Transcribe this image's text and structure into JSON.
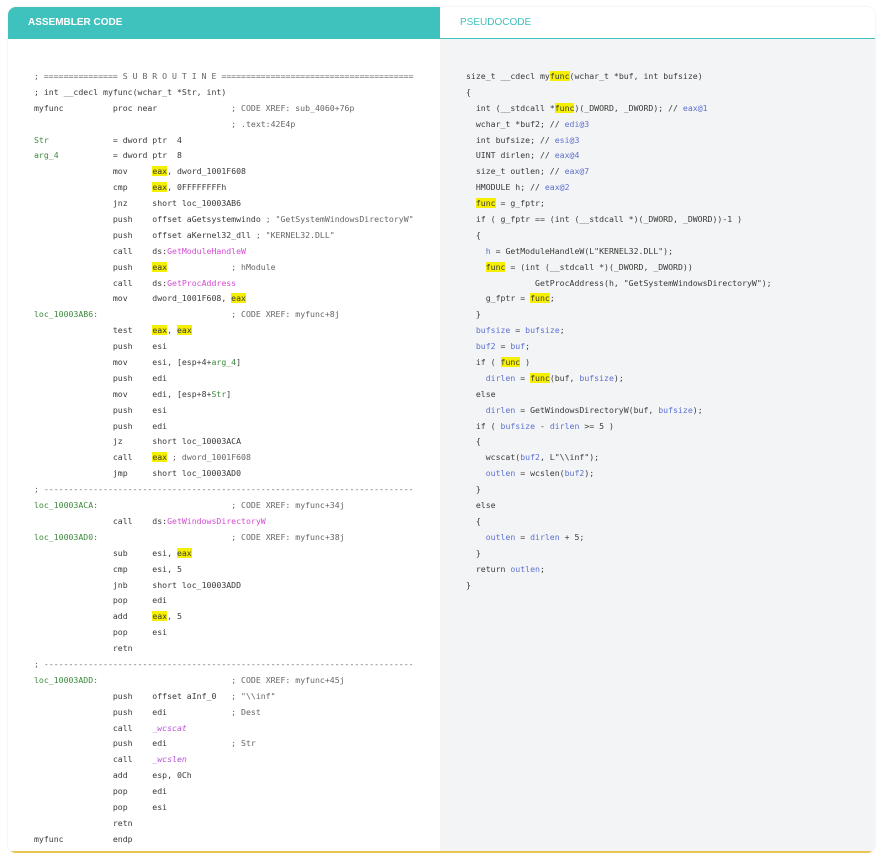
{
  "tabs": {
    "assembler": "ASSEMBLER CODE",
    "pseudocode": "PSEUDOCODE"
  },
  "colors": {
    "accent": "#3fc1bd",
    "highlight": "#f6f000",
    "label": "#3e8a3e",
    "function": "#d44bd4",
    "variable": "#5e71d1",
    "bottom_bar": "#e9c54d"
  },
  "assembler": [
    [
      {
        "t": "; =============== S U B R O U T I N E =======================================",
        "c": "cm"
      }
    ],
    [
      {
        "t": "; int __cdecl myfunc(wchar_t *Str, int)",
        "c": ""
      }
    ],
    [
      {
        "t": "myfunc          proc near               ",
        "c": ""
      },
      {
        "t": "; CODE XREF: sub_4060+76p",
        "c": "cm"
      }
    ],
    [
      {
        "t": "                                        ",
        "c": ""
      },
      {
        "t": "; .text:42E4p",
        "c": "cm"
      }
    ],
    [
      {
        "t": "Str",
        "c": "lbl"
      },
      {
        "t": "             = dword ptr  4",
        "c": ""
      }
    ],
    [
      {
        "t": "arg_4",
        "c": "lbl"
      },
      {
        "t": "           = dword ptr  8",
        "c": ""
      }
    ],
    [
      {
        "t": "                mov     ",
        "c": ""
      },
      {
        "t": "eax",
        "c": "hl"
      },
      {
        "t": ", dword_1001F608",
        "c": ""
      }
    ],
    [
      {
        "t": "                cmp     ",
        "c": ""
      },
      {
        "t": "eax",
        "c": "hl"
      },
      {
        "t": ", 0FFFFFFFFh",
        "c": ""
      }
    ],
    [
      {
        "t": "                jnz     short loc_10003AB6",
        "c": ""
      }
    ],
    [
      {
        "t": "                push    offset aGetsystemwindo ",
        "c": ""
      },
      {
        "t": "; \"GetSystemWindowsDirectoryW\"",
        "c": "cm"
      }
    ],
    [
      {
        "t": "                push    offset aKernel32_dll ",
        "c": ""
      },
      {
        "t": "; \"KERNEL32.DLL\"",
        "c": "cm"
      }
    ],
    [
      {
        "t": "                call    ds:",
        "c": ""
      },
      {
        "t": "GetModuleHandleW",
        "c": "fn"
      }
    ],
    [
      {
        "t": "                push    ",
        "c": ""
      },
      {
        "t": "eax",
        "c": "hl"
      },
      {
        "t": "             ",
        "c": ""
      },
      {
        "t": "; hModule",
        "c": "cm"
      }
    ],
    [
      {
        "t": "                call    ds:",
        "c": ""
      },
      {
        "t": "GetProcAddress",
        "c": "fn"
      }
    ],
    [
      {
        "t": "                mov     dword_1001F608, ",
        "c": ""
      },
      {
        "t": "eax",
        "c": "hl"
      }
    ],
    [
      {
        "t": "loc_10003AB6:",
        "c": "lbl"
      },
      {
        "t": "                           ",
        "c": ""
      },
      {
        "t": "; CODE XREF: myfunc+8j",
        "c": "cm"
      }
    ],
    [
      {
        "t": "                test    ",
        "c": ""
      },
      {
        "t": "eax",
        "c": "hl"
      },
      {
        "t": ", ",
        "c": ""
      },
      {
        "t": "eax",
        "c": "hl"
      }
    ],
    [
      {
        "t": "                push    esi",
        "c": ""
      }
    ],
    [
      {
        "t": "                mov     esi, [esp+4+",
        "c": ""
      },
      {
        "t": "arg_4",
        "c": "lbl"
      },
      {
        "t": "]",
        "c": ""
      }
    ],
    [
      {
        "t": "                push    edi",
        "c": ""
      }
    ],
    [
      {
        "t": "                mov     edi, [esp+8+",
        "c": ""
      },
      {
        "t": "Str",
        "c": "lbl"
      },
      {
        "t": "]",
        "c": ""
      }
    ],
    [
      {
        "t": "                push    esi",
        "c": ""
      }
    ],
    [
      {
        "t": "                push    edi",
        "c": ""
      }
    ],
    [
      {
        "t": "                jz      short loc_10003ACA",
        "c": ""
      }
    ],
    [
      {
        "t": "                call    ",
        "c": ""
      },
      {
        "t": "eax",
        "c": "hl"
      },
      {
        "t": " ",
        "c": ""
      },
      {
        "t": "; dword_1001F608",
        "c": "cm"
      }
    ],
    [
      {
        "t": "                jmp     short loc_10003AD0",
        "c": ""
      }
    ],
    [
      {
        "t": "; ---------------------------------------------------------------------------",
        "c": "cm"
      }
    ],
    [
      {
        "t": "loc_10003ACA:",
        "c": "lbl"
      },
      {
        "t": "                           ",
        "c": ""
      },
      {
        "t": "; CODE XREF: myfunc+34j",
        "c": "cm"
      }
    ],
    [
      {
        "t": "                call    ds:",
        "c": ""
      },
      {
        "t": "GetWindowsDirectoryW",
        "c": "fn"
      }
    ],
    [
      {
        "t": "loc_10003AD0:",
        "c": "lbl"
      },
      {
        "t": "                           ",
        "c": ""
      },
      {
        "t": "; CODE XREF: myfunc+38j",
        "c": "cm"
      }
    ],
    [
      {
        "t": "                sub     esi, ",
        "c": ""
      },
      {
        "t": "eax",
        "c": "hl"
      }
    ],
    [
      {
        "t": "                cmp     esi, 5",
        "c": ""
      }
    ],
    [
      {
        "t": "                jnb     short loc_10003ADD",
        "c": ""
      }
    ],
    [
      {
        "t": "                pop     edi",
        "c": ""
      }
    ],
    [
      {
        "t": "                add     ",
        "c": ""
      },
      {
        "t": "eax",
        "c": "hl"
      },
      {
        "t": ", 5",
        "c": ""
      }
    ],
    [
      {
        "t": "                pop     esi",
        "c": ""
      }
    ],
    [
      {
        "t": "                retn",
        "c": ""
      }
    ],
    [
      {
        "t": "; ---------------------------------------------------------------------------",
        "c": "cm"
      }
    ],
    [
      {
        "t": "loc_10003ADD:",
        "c": "lbl"
      },
      {
        "t": "                           ",
        "c": ""
      },
      {
        "t": "; CODE XREF: myfunc+45j",
        "c": "cm"
      }
    ],
    [
      {
        "t": "                push    offset aInf_0   ",
        "c": ""
      },
      {
        "t": "; \"\\\\inf\"",
        "c": "cm"
      }
    ],
    [
      {
        "t": "                push    edi             ",
        "c": ""
      },
      {
        "t": "; Dest",
        "c": "cm"
      }
    ],
    [
      {
        "t": "                call    ",
        "c": ""
      },
      {
        "t": "_wcscat",
        "c": "imp"
      }
    ],
    [
      {
        "t": "                push    edi             ",
        "c": ""
      },
      {
        "t": "; Str",
        "c": "cm"
      }
    ],
    [
      {
        "t": "                call    ",
        "c": ""
      },
      {
        "t": "_wcslen",
        "c": "imp"
      }
    ],
    [
      {
        "t": "                add     esp, 0Ch",
        "c": ""
      }
    ],
    [
      {
        "t": "                pop     edi",
        "c": ""
      }
    ],
    [
      {
        "t": "                pop     esi",
        "c": ""
      }
    ],
    [
      {
        "t": "                retn",
        "c": ""
      }
    ],
    [
      {
        "t": "myfunc          endp",
        "c": ""
      }
    ]
  ],
  "pseudocode": [
    [
      {
        "t": "size_t __cdecl my",
        "c": ""
      },
      {
        "t": "func",
        "c": "hl"
      },
      {
        "t": "(wchar_t *buf, int bufsize)",
        "c": ""
      }
    ],
    [
      {
        "t": "{",
        "c": ""
      }
    ],
    [
      {
        "t": "  int (__stdcall *",
        "c": ""
      },
      {
        "t": "func",
        "c": "hl"
      },
      {
        "t": ")(_DWORD, _DWORD); // ",
        "c": ""
      },
      {
        "t": "eax@1",
        "c": "var"
      }
    ],
    [
      {
        "t": "  wchar_t *buf2; // ",
        "c": ""
      },
      {
        "t": "edi@3",
        "c": "var"
      }
    ],
    [
      {
        "t": "  int bufsize; // ",
        "c": ""
      },
      {
        "t": "esi@3",
        "c": "var"
      }
    ],
    [
      {
        "t": "  UINT dirlen; // ",
        "c": ""
      },
      {
        "t": "eax@4",
        "c": "var"
      }
    ],
    [
      {
        "t": "  size_t outlen; // ",
        "c": ""
      },
      {
        "t": "eax@7",
        "c": "var"
      }
    ],
    [
      {
        "t": "  HMODULE h; // ",
        "c": ""
      },
      {
        "t": "eax@2",
        "c": "var"
      }
    ],
    [
      {
        "t": "  ",
        "c": ""
      },
      {
        "t": "func",
        "c": "hl"
      },
      {
        "t": " = g_fptr;",
        "c": ""
      }
    ],
    [
      {
        "t": "  if ( g_fptr == (int (__stdcall *)(_DWORD, _DWORD))-1 )",
        "c": ""
      }
    ],
    [
      {
        "t": "  {",
        "c": ""
      }
    ],
    [
      {
        "t": "    ",
        "c": ""
      },
      {
        "t": "h",
        "c": "var"
      },
      {
        "t": " = GetModuleHandleW(L\"KERNEL32.DLL\");",
        "c": ""
      }
    ],
    [
      {
        "t": "    ",
        "c": ""
      },
      {
        "t": "func",
        "c": "hl"
      },
      {
        "t": " = (int (__stdcall *)(_DWORD, _DWORD))",
        "c": ""
      }
    ],
    [
      {
        "t": "              GetProcAddress(h, \"GetSystemWindowsDirectoryW\");",
        "c": ""
      }
    ],
    [
      {
        "t": "    g_fptr = ",
        "c": ""
      },
      {
        "t": "func",
        "c": "hl"
      },
      {
        "t": ";",
        "c": ""
      }
    ],
    [
      {
        "t": "  }",
        "c": ""
      }
    ],
    [
      {
        "t": "  bufsize",
        "c": "var"
      },
      {
        "t": " = ",
        "c": ""
      },
      {
        "t": "bufsize",
        "c": "var"
      },
      {
        "t": ";",
        "c": ""
      }
    ],
    [
      {
        "t": "  buf2",
        "c": "var"
      },
      {
        "t": " = ",
        "c": ""
      },
      {
        "t": "buf",
        "c": "var"
      },
      {
        "t": ";",
        "c": ""
      }
    ],
    [
      {
        "t": "  if ( ",
        "c": ""
      },
      {
        "t": "func",
        "c": "hl"
      },
      {
        "t": " )",
        "c": ""
      }
    ],
    [
      {
        "t": "    ",
        "c": ""
      },
      {
        "t": "dirlen",
        "c": "var"
      },
      {
        "t": " = ",
        "c": ""
      },
      {
        "t": "func",
        "c": "hl"
      },
      {
        "t": "(buf, ",
        "c": ""
      },
      {
        "t": "bufsize",
        "c": "var"
      },
      {
        "t": ");",
        "c": ""
      }
    ],
    [
      {
        "t": "  else",
        "c": ""
      }
    ],
    [
      {
        "t": "    ",
        "c": ""
      },
      {
        "t": "dirlen",
        "c": "var"
      },
      {
        "t": " = GetWindowsDirectoryW(buf, ",
        "c": ""
      },
      {
        "t": "bufsize",
        "c": "var"
      },
      {
        "t": ");",
        "c": ""
      }
    ],
    [
      {
        "t": "  if ( ",
        "c": ""
      },
      {
        "t": "bufsize",
        "c": "var"
      },
      {
        "t": " - ",
        "c": ""
      },
      {
        "t": "dirlen",
        "c": "var"
      },
      {
        "t": " >= 5 )",
        "c": ""
      }
    ],
    [
      {
        "t": "  {",
        "c": ""
      }
    ],
    [
      {
        "t": "    wcscat(",
        "c": ""
      },
      {
        "t": "buf2",
        "c": "var"
      },
      {
        "t": ", L\"\\\\inf\");",
        "c": ""
      }
    ],
    [
      {
        "t": "    ",
        "c": ""
      },
      {
        "t": "outlen",
        "c": "var"
      },
      {
        "t": " = wcslen(",
        "c": ""
      },
      {
        "t": "buf2",
        "c": "var"
      },
      {
        "t": ");",
        "c": ""
      }
    ],
    [
      {
        "t": "  }",
        "c": ""
      }
    ],
    [
      {
        "t": "  else",
        "c": ""
      }
    ],
    [
      {
        "t": "  {",
        "c": ""
      }
    ],
    [
      {
        "t": "    ",
        "c": ""
      },
      {
        "t": "outlen",
        "c": "var"
      },
      {
        "t": " = ",
        "c": ""
      },
      {
        "t": "dirlen",
        "c": "var"
      },
      {
        "t": " + 5;",
        "c": ""
      }
    ],
    [
      {
        "t": "  }",
        "c": ""
      }
    ],
    [
      {
        "t": "  return ",
        "c": ""
      },
      {
        "t": "outlen",
        "c": "var"
      },
      {
        "t": ";",
        "c": ""
      }
    ],
    [
      {
        "t": "}",
        "c": ""
      }
    ]
  ]
}
